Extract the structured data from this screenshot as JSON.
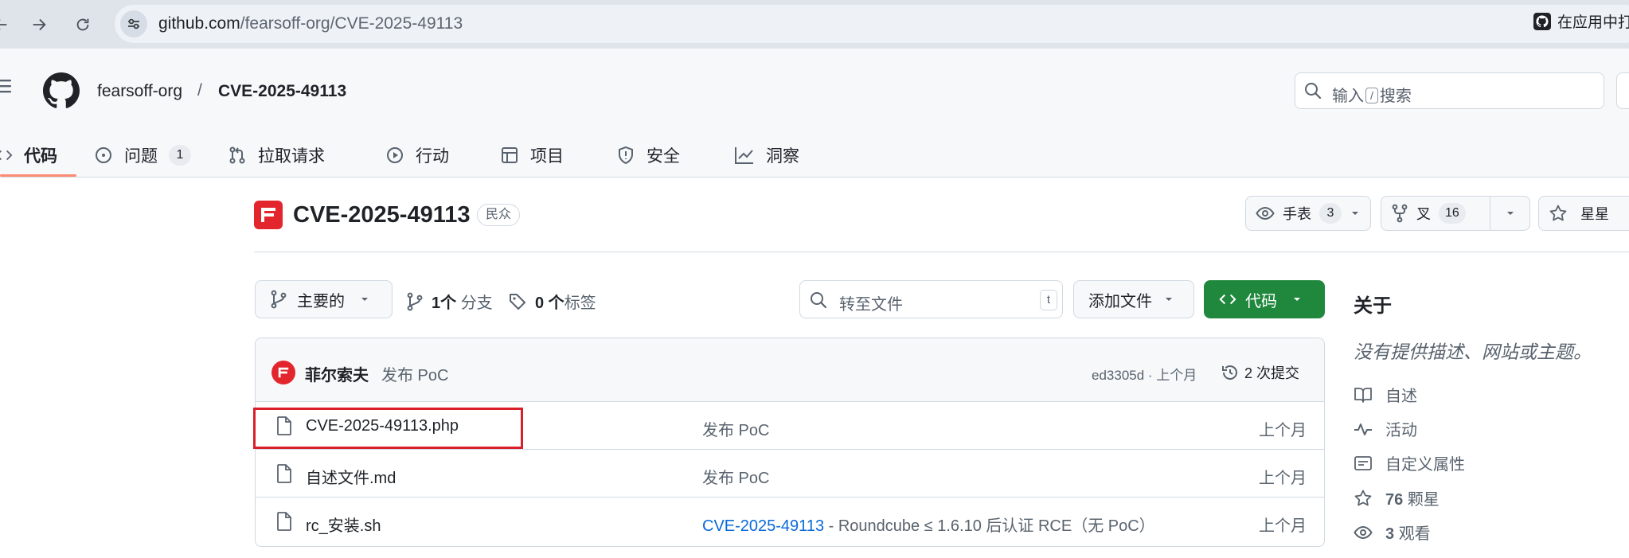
{
  "browser": {
    "url_host": "github.com",
    "url_path": "/fearsoff-org/CVE-2025-49113",
    "open_in_app": "在应用中打"
  },
  "header": {
    "owner": "fearsoff-org",
    "separator": "/",
    "repo": "CVE-2025-49113",
    "search_prefix": "输入",
    "search_key": "/",
    "search_suffix": "搜索"
  },
  "tabs": [
    {
      "label": "代码",
      "icon": "code-icon"
    },
    {
      "label": "问题",
      "icon": "issue-icon",
      "count": "1"
    },
    {
      "label": "拉取请求",
      "icon": "pull-request-icon"
    },
    {
      "label": "行动",
      "icon": "play-icon"
    },
    {
      "label": "项目",
      "icon": "table-icon"
    },
    {
      "label": "安全",
      "icon": "shield-icon"
    },
    {
      "label": "洞察",
      "icon": "graph-icon"
    }
  ],
  "repo": {
    "title": "CVE-2025-49113",
    "visibility": "民众",
    "watch_label": "手表",
    "watch_count": "3",
    "fork_label": "叉",
    "fork_count": "16",
    "star_label": "星星"
  },
  "toolbar": {
    "branch": "主要的",
    "branches_count": "1个",
    "branches_label": "分支",
    "tags_count": "0 个",
    "tags_label": "标签",
    "goto_placeholder": "转至文件",
    "goto_key": "t",
    "add_file": "添加文件",
    "code": "代码"
  },
  "commit": {
    "author": "菲尔索夫",
    "message": "发布 PoC",
    "meta": "ed3305d · 上个月",
    "count": "2 次提交"
  },
  "files": [
    {
      "name": "CVE-2025-49113.php",
      "message": "发布 PoC",
      "message_link": "",
      "date": "上个月"
    },
    {
      "name": "自述文件.md",
      "message": "发布 PoC",
      "message_link": "",
      "date": "上个月"
    },
    {
      "name": "rc_安装.sh",
      "message_link": "CVE-2025-49113",
      "message": " - Roundcube ≤ 1.6.10 后认证 RCE（无 PoC）",
      "date": "上个月"
    }
  ],
  "about": {
    "title": "关于",
    "description": "没有提供描述、网站或主题。",
    "items": [
      {
        "icon": "book-icon",
        "label": "自述"
      },
      {
        "icon": "pulse-icon",
        "label": "活动"
      },
      {
        "icon": "note-icon",
        "label": "自定义属性"
      },
      {
        "icon": "star-icon",
        "count": "76",
        "label": "颗星"
      },
      {
        "icon": "eye-icon",
        "count": "3",
        "label": "观看"
      }
    ]
  },
  "colors": {
    "accent_underline": "#fd8c73",
    "code_button": "#1f883d",
    "brand_red": "#e3262e",
    "link": "#0969da",
    "highlight": "#d9202a"
  }
}
